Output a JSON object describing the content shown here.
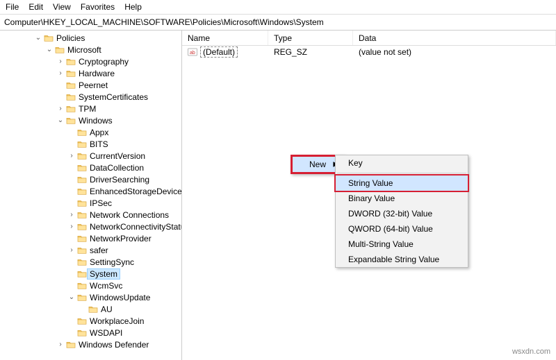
{
  "menu": {
    "file": "File",
    "edit": "Edit",
    "view": "View",
    "favorites": "Favorites",
    "help": "Help"
  },
  "path": "Computer\\HKEY_LOCAL_MACHINE\\SOFTWARE\\Policies\\Microsoft\\Windows\\System",
  "tree": [
    {
      "depth": 3,
      "exp": "open",
      "label": "Policies"
    },
    {
      "depth": 4,
      "exp": "open",
      "label": "Microsoft"
    },
    {
      "depth": 5,
      "exp": "closed",
      "label": "Cryptography"
    },
    {
      "depth": 5,
      "exp": "closed",
      "label": "Hardware"
    },
    {
      "depth": 5,
      "exp": "none",
      "label": "Peernet"
    },
    {
      "depth": 5,
      "exp": "none",
      "label": "SystemCertificates"
    },
    {
      "depth": 5,
      "exp": "closed",
      "label": "TPM"
    },
    {
      "depth": 5,
      "exp": "open",
      "label": "Windows"
    },
    {
      "depth": 6,
      "exp": "none",
      "label": "Appx"
    },
    {
      "depth": 6,
      "exp": "none",
      "label": "BITS"
    },
    {
      "depth": 6,
      "exp": "closed",
      "label": "CurrentVersion"
    },
    {
      "depth": 6,
      "exp": "none",
      "label": "DataCollection"
    },
    {
      "depth": 6,
      "exp": "none",
      "label": "DriverSearching"
    },
    {
      "depth": 6,
      "exp": "none",
      "label": "EnhancedStorageDevices"
    },
    {
      "depth": 6,
      "exp": "none",
      "label": "IPSec"
    },
    {
      "depth": 6,
      "exp": "closed",
      "label": "Network Connections"
    },
    {
      "depth": 6,
      "exp": "closed",
      "label": "NetworkConnectivityStatus"
    },
    {
      "depth": 6,
      "exp": "none",
      "label": "NetworkProvider"
    },
    {
      "depth": 6,
      "exp": "closed",
      "label": "safer"
    },
    {
      "depth": 6,
      "exp": "none",
      "label": "SettingSync"
    },
    {
      "depth": 6,
      "exp": "none",
      "label": "System",
      "selected": true
    },
    {
      "depth": 6,
      "exp": "none",
      "label": "WcmSvc"
    },
    {
      "depth": 6,
      "exp": "open",
      "label": "WindowsUpdate"
    },
    {
      "depth": 7,
      "exp": "none",
      "label": "AU"
    },
    {
      "depth": 6,
      "exp": "none",
      "label": "WorkplaceJoin"
    },
    {
      "depth": 6,
      "exp": "none",
      "label": "WSDAPI"
    },
    {
      "depth": 5,
      "exp": "closed",
      "label": "Windows Defender"
    }
  ],
  "columns": {
    "name": "Name",
    "type": "Type",
    "data": "Data"
  },
  "rows": [
    {
      "name": "(Default)",
      "type": "REG_SZ",
      "data": "(value not set)",
      "default": true
    }
  ],
  "ctx": {
    "new": "New",
    "sub": [
      {
        "label": "Key"
      },
      {
        "sep": true
      },
      {
        "label": "String Value",
        "hot": true,
        "box": true
      },
      {
        "label": "Binary Value"
      },
      {
        "label": "DWORD (32-bit) Value"
      },
      {
        "label": "QWORD (64-bit) Value"
      },
      {
        "label": "Multi-String Value"
      },
      {
        "label": "Expandable String Value"
      }
    ]
  },
  "watermark": "wsxdn.com"
}
